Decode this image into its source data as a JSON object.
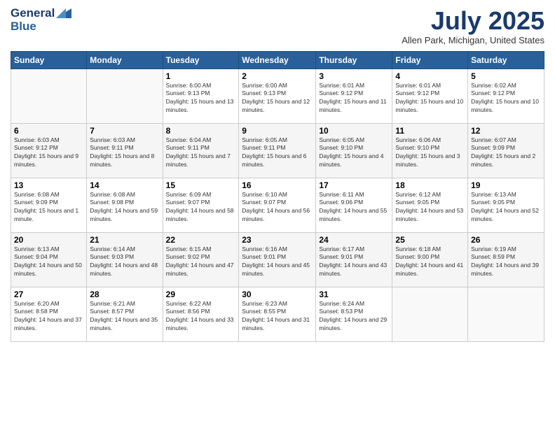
{
  "header": {
    "logo_line1": "General",
    "logo_line2": "Blue",
    "month_title": "July 2025",
    "location": "Allen Park, Michigan, United States"
  },
  "weekdays": [
    "Sunday",
    "Monday",
    "Tuesday",
    "Wednesday",
    "Thursday",
    "Friday",
    "Saturday"
  ],
  "weeks": [
    [
      {
        "day": "",
        "sunrise": "",
        "sunset": "",
        "daylight": ""
      },
      {
        "day": "",
        "sunrise": "",
        "sunset": "",
        "daylight": ""
      },
      {
        "day": "1",
        "sunrise": "Sunrise: 6:00 AM",
        "sunset": "Sunset: 9:13 PM",
        "daylight": "Daylight: 15 hours and 13 minutes."
      },
      {
        "day": "2",
        "sunrise": "Sunrise: 6:00 AM",
        "sunset": "Sunset: 9:13 PM",
        "daylight": "Daylight: 15 hours and 12 minutes."
      },
      {
        "day": "3",
        "sunrise": "Sunrise: 6:01 AM",
        "sunset": "Sunset: 9:12 PM",
        "daylight": "Daylight: 15 hours and 11 minutes."
      },
      {
        "day": "4",
        "sunrise": "Sunrise: 6:01 AM",
        "sunset": "Sunset: 9:12 PM",
        "daylight": "Daylight: 15 hours and 10 minutes."
      },
      {
        "day": "5",
        "sunrise": "Sunrise: 6:02 AM",
        "sunset": "Sunset: 9:12 PM",
        "daylight": "Daylight: 15 hours and 10 minutes."
      }
    ],
    [
      {
        "day": "6",
        "sunrise": "Sunrise: 6:03 AM",
        "sunset": "Sunset: 9:12 PM",
        "daylight": "Daylight: 15 hours and 9 minutes."
      },
      {
        "day": "7",
        "sunrise": "Sunrise: 6:03 AM",
        "sunset": "Sunset: 9:11 PM",
        "daylight": "Daylight: 15 hours and 8 minutes."
      },
      {
        "day": "8",
        "sunrise": "Sunrise: 6:04 AM",
        "sunset": "Sunset: 9:11 PM",
        "daylight": "Daylight: 15 hours and 7 minutes."
      },
      {
        "day": "9",
        "sunrise": "Sunrise: 6:05 AM",
        "sunset": "Sunset: 9:11 PM",
        "daylight": "Daylight: 15 hours and 6 minutes."
      },
      {
        "day": "10",
        "sunrise": "Sunrise: 6:05 AM",
        "sunset": "Sunset: 9:10 PM",
        "daylight": "Daylight: 15 hours and 4 minutes."
      },
      {
        "day": "11",
        "sunrise": "Sunrise: 6:06 AM",
        "sunset": "Sunset: 9:10 PM",
        "daylight": "Daylight: 15 hours and 3 minutes."
      },
      {
        "day": "12",
        "sunrise": "Sunrise: 6:07 AM",
        "sunset": "Sunset: 9:09 PM",
        "daylight": "Daylight: 15 hours and 2 minutes."
      }
    ],
    [
      {
        "day": "13",
        "sunrise": "Sunrise: 6:08 AM",
        "sunset": "Sunset: 9:09 PM",
        "daylight": "Daylight: 15 hours and 1 minute."
      },
      {
        "day": "14",
        "sunrise": "Sunrise: 6:08 AM",
        "sunset": "Sunset: 9:08 PM",
        "daylight": "Daylight: 14 hours and 59 minutes."
      },
      {
        "day": "15",
        "sunrise": "Sunrise: 6:09 AM",
        "sunset": "Sunset: 9:07 PM",
        "daylight": "Daylight: 14 hours and 58 minutes."
      },
      {
        "day": "16",
        "sunrise": "Sunrise: 6:10 AM",
        "sunset": "Sunset: 9:07 PM",
        "daylight": "Daylight: 14 hours and 56 minutes."
      },
      {
        "day": "17",
        "sunrise": "Sunrise: 6:11 AM",
        "sunset": "Sunset: 9:06 PM",
        "daylight": "Daylight: 14 hours and 55 minutes."
      },
      {
        "day": "18",
        "sunrise": "Sunrise: 6:12 AM",
        "sunset": "Sunset: 9:05 PM",
        "daylight": "Daylight: 14 hours and 53 minutes."
      },
      {
        "day": "19",
        "sunrise": "Sunrise: 6:13 AM",
        "sunset": "Sunset: 9:05 PM",
        "daylight": "Daylight: 14 hours and 52 minutes."
      }
    ],
    [
      {
        "day": "20",
        "sunrise": "Sunrise: 6:13 AM",
        "sunset": "Sunset: 9:04 PM",
        "daylight": "Daylight: 14 hours and 50 minutes."
      },
      {
        "day": "21",
        "sunrise": "Sunrise: 6:14 AM",
        "sunset": "Sunset: 9:03 PM",
        "daylight": "Daylight: 14 hours and 48 minutes."
      },
      {
        "day": "22",
        "sunrise": "Sunrise: 6:15 AM",
        "sunset": "Sunset: 9:02 PM",
        "daylight": "Daylight: 14 hours and 47 minutes."
      },
      {
        "day": "23",
        "sunrise": "Sunrise: 6:16 AM",
        "sunset": "Sunset: 9:01 PM",
        "daylight": "Daylight: 14 hours and 45 minutes."
      },
      {
        "day": "24",
        "sunrise": "Sunrise: 6:17 AM",
        "sunset": "Sunset: 9:01 PM",
        "daylight": "Daylight: 14 hours and 43 minutes."
      },
      {
        "day": "25",
        "sunrise": "Sunrise: 6:18 AM",
        "sunset": "Sunset: 9:00 PM",
        "daylight": "Daylight: 14 hours and 41 minutes."
      },
      {
        "day": "26",
        "sunrise": "Sunrise: 6:19 AM",
        "sunset": "Sunset: 8:59 PM",
        "daylight": "Daylight: 14 hours and 39 minutes."
      }
    ],
    [
      {
        "day": "27",
        "sunrise": "Sunrise: 6:20 AM",
        "sunset": "Sunset: 8:58 PM",
        "daylight": "Daylight: 14 hours and 37 minutes."
      },
      {
        "day": "28",
        "sunrise": "Sunrise: 6:21 AM",
        "sunset": "Sunset: 8:57 PM",
        "daylight": "Daylight: 14 hours and 35 minutes."
      },
      {
        "day": "29",
        "sunrise": "Sunrise: 6:22 AM",
        "sunset": "Sunset: 8:56 PM",
        "daylight": "Daylight: 14 hours and 33 minutes."
      },
      {
        "day": "30",
        "sunrise": "Sunrise: 6:23 AM",
        "sunset": "Sunset: 8:55 PM",
        "daylight": "Daylight: 14 hours and 31 minutes."
      },
      {
        "day": "31",
        "sunrise": "Sunrise: 6:24 AM",
        "sunset": "Sunset: 8:53 PM",
        "daylight": "Daylight: 14 hours and 29 minutes."
      },
      {
        "day": "",
        "sunrise": "",
        "sunset": "",
        "daylight": ""
      },
      {
        "day": "",
        "sunrise": "",
        "sunset": "",
        "daylight": ""
      }
    ]
  ]
}
